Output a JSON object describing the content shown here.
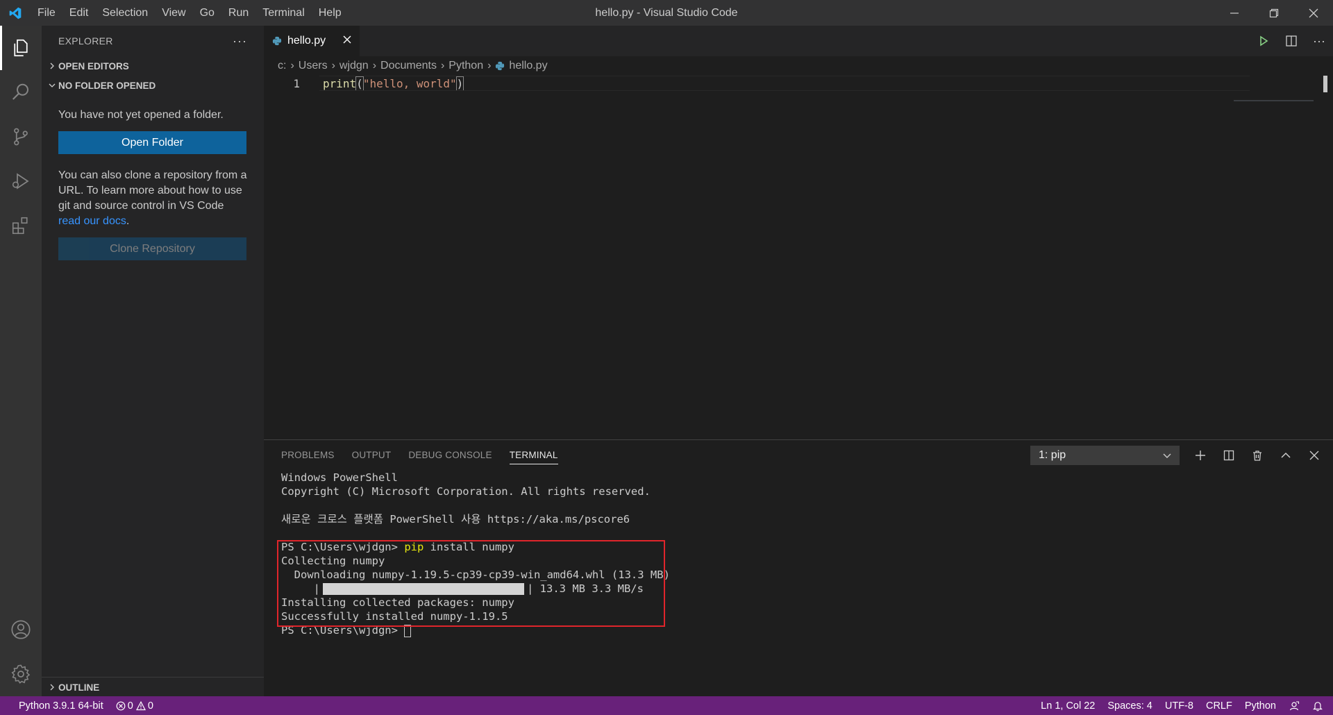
{
  "window": {
    "title": "hello.py - Visual Studio Code"
  },
  "menu": [
    "File",
    "Edit",
    "Selection",
    "View",
    "Go",
    "Run",
    "Terminal",
    "Help"
  ],
  "activity_bar": {
    "items": [
      "explorer-icon",
      "search-icon",
      "source-control-icon",
      "run-debug-icon",
      "extensions-icon"
    ],
    "bottom": [
      "account-icon",
      "gear-icon"
    ]
  },
  "sidebar": {
    "header": "EXPLORER",
    "open_editors": "OPEN EDITORS",
    "no_folder": "NO FOLDER OPENED",
    "message": "You have not yet opened a folder.",
    "open_folder_button": "Open Folder",
    "clone_text": "You can also clone a repository from a URL. To learn more about how to use git and source control in VS Code ",
    "docs_link": "read our docs",
    "period": ".",
    "clone_button": "Clone Repository",
    "outline": "OUTLINE"
  },
  "editor": {
    "tab_label": "hello.py",
    "breadcrumb": [
      "c:",
      "Users",
      "wjdgn",
      "Documents",
      "Python",
      "hello.py"
    ],
    "lines": [
      {
        "number": "1",
        "fn": "print",
        "open": "(",
        "str": "\"hello, world\"",
        "close": ")"
      }
    ]
  },
  "panel": {
    "tabs": [
      "PROBLEMS",
      "OUTPUT",
      "DEBUG CONSOLE",
      "TERMINAL"
    ],
    "active_tab": "TERMINAL",
    "terminal_select": "1: pip",
    "terminal": {
      "l1": "Windows PowerShell",
      "l2": "Copyright (C) Microsoft Corporation. All rights reserved.",
      "l3": "새로운 크로스 플랫폼 PowerShell 사용 https://aka.ms/pscore6",
      "prompt": "PS C:\\Users\\wjdgn> ",
      "cmd_pip": "pip",
      "cmd_rest": " install numpy",
      "l5": "Collecting numpy",
      "l6": "  Downloading numpy-1.19.5-cp39-cp39-win_amd64.whl (13.3 MB)",
      "progress_prefix": "     |",
      "progress_fraction": 1.0,
      "progress_suffix": "| 13.3 MB 3.3 MB/s",
      "l8": "Installing collected packages: numpy",
      "l9": "Successfully installed numpy-1.19.5",
      "l10": "PS C:\\Users\\wjdgn> "
    }
  },
  "statusbar": {
    "python": "Python 3.9.1 64-bit",
    "errors": "0",
    "warnings": "0",
    "position": "Ln 1, Col 22",
    "spaces": "Spaces: 4",
    "encoding": "UTF-8",
    "eol": "CRLF",
    "language": "Python"
  },
  "colors": {
    "statusbar": "#68217a",
    "primary_button": "#0e639c",
    "highlight_box": "#e0252b",
    "vscode_blue": "#23a9f2"
  }
}
